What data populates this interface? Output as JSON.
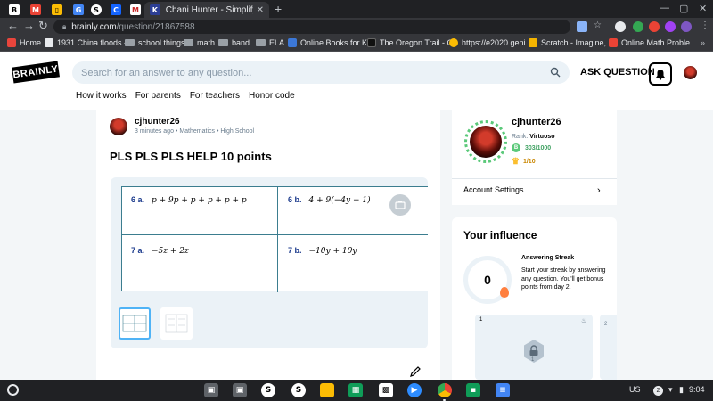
{
  "browser": {
    "active_tab_title": "Chani Hunter - Simplify Expressi",
    "url_host": "brainly.com",
    "url_path": "/question/21867588",
    "bookmarks": [
      {
        "label": "Home",
        "icon": "home-icon",
        "color": "#e8453c"
      },
      {
        "label": "1931 China floods -...",
        "icon": "wikipedia-icon",
        "color": "#e8eaed"
      },
      {
        "label": "school things",
        "icon": "folder-icon",
        "color": "#9aa0a6"
      },
      {
        "label": "math",
        "icon": "folder-icon",
        "color": "#9aa0a6"
      },
      {
        "label": "band",
        "icon": "folder-icon",
        "color": "#9aa0a6"
      },
      {
        "label": "ELA",
        "icon": "folder-icon",
        "color": "#9aa0a6"
      },
      {
        "label": "Online Books for Ki...",
        "icon": "books-icon",
        "color": "#3c78d8"
      },
      {
        "label": "The Oregon Trail - O...",
        "icon": "oregon-icon",
        "color": "#111111"
      },
      {
        "label": "https://e2020.geni...",
        "icon": "bulb-icon",
        "color": "#fbbc04"
      },
      {
        "label": "Scratch - Imagine,...",
        "icon": "scratch-icon",
        "color": "#f4b400"
      },
      {
        "label": "Online Math Proble...",
        "icon": "gmail-icon",
        "color": "#ea4335"
      }
    ]
  },
  "header": {
    "logo": "BRAINLY",
    "search_placeholder": "Search for an answer to any question...",
    "ask_label": "ASK QUESTION",
    "nav": [
      "How it works",
      "For parents",
      "For teachers",
      "Honor code"
    ]
  },
  "question": {
    "author": "cjhunter26",
    "time": "3 minutes ago",
    "subject": "Mathematics",
    "level": "High School",
    "title": "PLS PLS PLS HELP 10 points",
    "worksheet": {
      "c6a_label": "6 a.",
      "c6a_expr": "p + 9p + p + p + p + p",
      "c6b_label": "6 b.",
      "c6b_expr": "4  +  9(−4y  −  1)",
      "c7a_label": "7 a.",
      "c7a_expr": "−5z  +  2z",
      "c7b_label": "7 b.",
      "c7b_expr": "−10y  +  10y"
    }
  },
  "profile": {
    "username": "cjhunter26",
    "rank_label": "Rank:",
    "rank_value": "Virtuoso",
    "points": "303/1000",
    "crown": "1/10",
    "settings": "Account Settings"
  },
  "influence": {
    "title": "Your influence",
    "streak_value": "0",
    "streak_heading": "Answering Streak",
    "streak_text": "Start your streak by answering any question. You'll get bonus points from day 2.",
    "tile1_num": "1",
    "tile1_badge": "1",
    "tile2_num": "2"
  },
  "taskbar": {
    "locale": "US",
    "notifications": "2",
    "time": "9:04"
  },
  "colors": {
    "brand_green": "#5bc97a",
    "accent_blue": "#4fb3f6",
    "page_bg": "#f3f6f8"
  }
}
